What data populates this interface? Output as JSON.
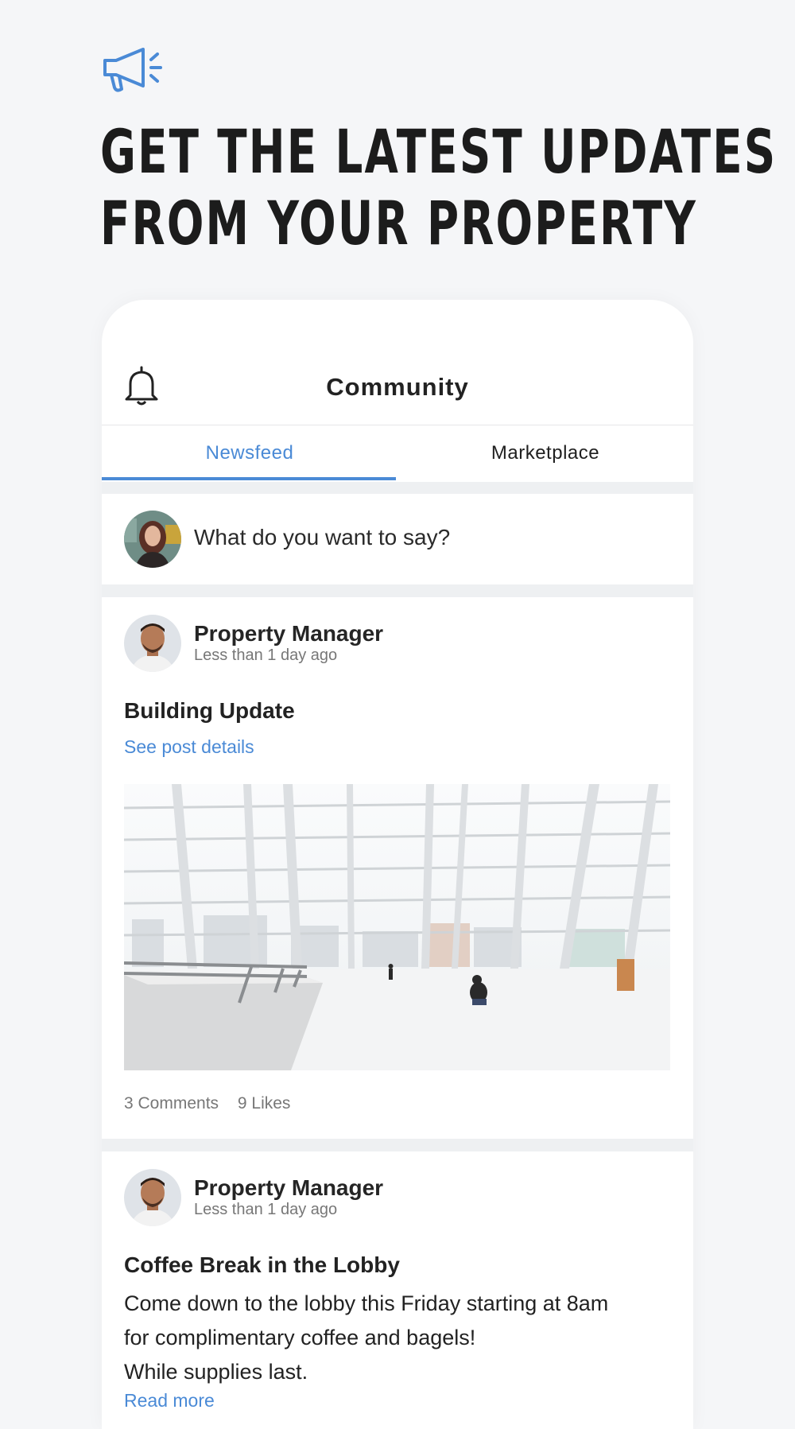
{
  "hero": {
    "icon": "megaphone-icon",
    "headline_line1": "GET THE LATEST UPDATES",
    "headline_line2": "FROM YOUR PROPERTY",
    "accent_color": "#4a8ad6"
  },
  "app": {
    "header": {
      "icon": "bell-icon",
      "title": "Community"
    },
    "tabs": [
      {
        "label": "Newsfeed",
        "active": true
      },
      {
        "label": "Marketplace",
        "active": false
      }
    ],
    "composer": {
      "placeholder": "What do you want to say?"
    },
    "posts": [
      {
        "author": "Property Manager",
        "time": "Less than 1 day ago",
        "title": "Building Update",
        "link": "See post details",
        "image": "building-lobby-photo",
        "comments": "3 Comments",
        "likes": "9 Likes"
      },
      {
        "author": "Property Manager",
        "time": "Less than 1 day ago",
        "title": "Coffee Break in the Lobby",
        "body_lines": [
          "Come down to the lobby this Friday starting at 8am",
          "for complimentary coffee and bagels!",
          "While supplies last."
        ],
        "link": "Read more"
      }
    ]
  }
}
